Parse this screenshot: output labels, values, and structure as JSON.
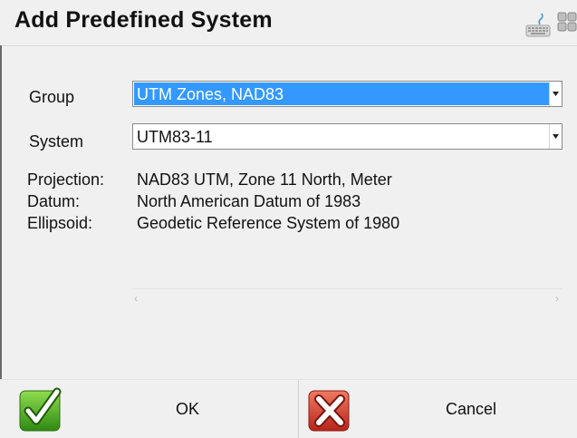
{
  "dialog": {
    "title": "Add Predefined System",
    "keyboard_icon": "keyboard-icon",
    "apps_icon": "apps-grid-icon"
  },
  "group": {
    "label": "Group",
    "value": "UTM Zones, NAD83"
  },
  "system": {
    "label": "System",
    "value": "UTM83-11"
  },
  "details": {
    "projection_key": "Projection:",
    "projection_value": "NAD83 UTM, Zone 11 North, Meter",
    "datum_key": "Datum:",
    "datum_value": "North American Datum of 1983",
    "ellipsoid_key": "Ellipsoid:",
    "ellipsoid_value": "Geodetic Reference System of 1980"
  },
  "scrollbar": {
    "left_arrow": "‹",
    "right_arrow": "›"
  },
  "buttons": {
    "ok_label": "OK",
    "ok_icon": "checkmark-icon",
    "cancel_label": "Cancel",
    "cancel_icon": "x-icon"
  },
  "colors": {
    "selection": "#3399ff",
    "ok_green": "#4caf1a",
    "cancel_red": "#d83a2a"
  }
}
